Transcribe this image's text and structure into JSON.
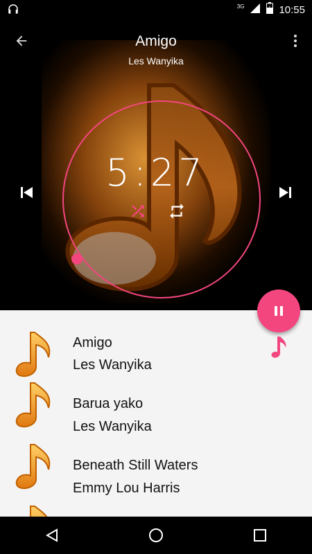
{
  "status_bar": {
    "time": "10:55",
    "network": "3G",
    "icons": [
      "headphones-icon",
      "wifi-icon",
      "signal-icon",
      "battery-icon"
    ]
  },
  "now_playing": {
    "title": "Amigo",
    "artist": "Les Wanyika",
    "time": "5:27",
    "progress_fraction": 0.92
  },
  "colors": {
    "accent": "#f3467f",
    "list_bg": "#f4f4f4",
    "note_orange": "#f0a020"
  },
  "playlist": {
    "items": [
      {
        "title": "Amigo",
        "artist": "Les Wanyika"
      },
      {
        "title": "Barua yako",
        "artist": "Les Wanyika"
      },
      {
        "title": "Beneath Still Waters",
        "artist": "Emmy Lou Harris"
      }
    ]
  }
}
